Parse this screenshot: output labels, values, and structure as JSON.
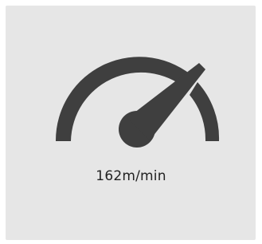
{
  "speed_widget": {
    "reading_label": "162m/min",
    "gauge_color": "#3f3f3f",
    "background_color": "#e6e6e6"
  }
}
